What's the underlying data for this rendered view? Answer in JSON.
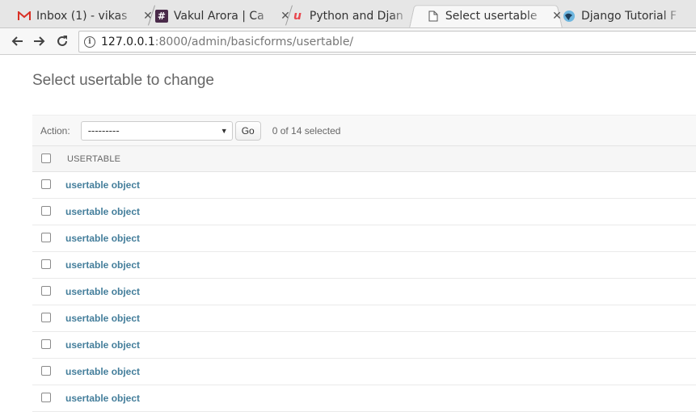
{
  "browser": {
    "tabs": [
      {
        "title": "Inbox (1) - vikas",
        "favicon": "gmail-icon",
        "active": false
      },
      {
        "title": "Vakul Arora | Ca",
        "favicon": "hash-icon",
        "active": false
      },
      {
        "title": "Python and Djan",
        "favicon": "u-logo-icon",
        "active": false
      },
      {
        "title": "Select usertable",
        "favicon": "page-icon",
        "active": true
      },
      {
        "title": "Django Tutorial F",
        "favicon": "globe-icon",
        "active": false
      }
    ],
    "url_host": "127.0.0.1",
    "url_rest": ":8000/admin/basicforms/usertable/"
  },
  "page": {
    "title": "Select usertable to change",
    "action_label": "Action:",
    "action_select_value": "---------",
    "go_label": "Go",
    "selection_counter": "0 of 14 selected",
    "column_header": "USERTABLE",
    "rows": [
      "usertable object",
      "usertable object",
      "usertable object",
      "usertable object",
      "usertable object",
      "usertable object",
      "usertable object",
      "usertable object",
      "usertable object"
    ]
  },
  "colors": {
    "link": "#447e9b",
    "tab_strip": "#e6e6e6",
    "gmail_red": "#d93025",
    "u_logo": "#e8474e",
    "hash_bg": "#4a2a4a"
  }
}
